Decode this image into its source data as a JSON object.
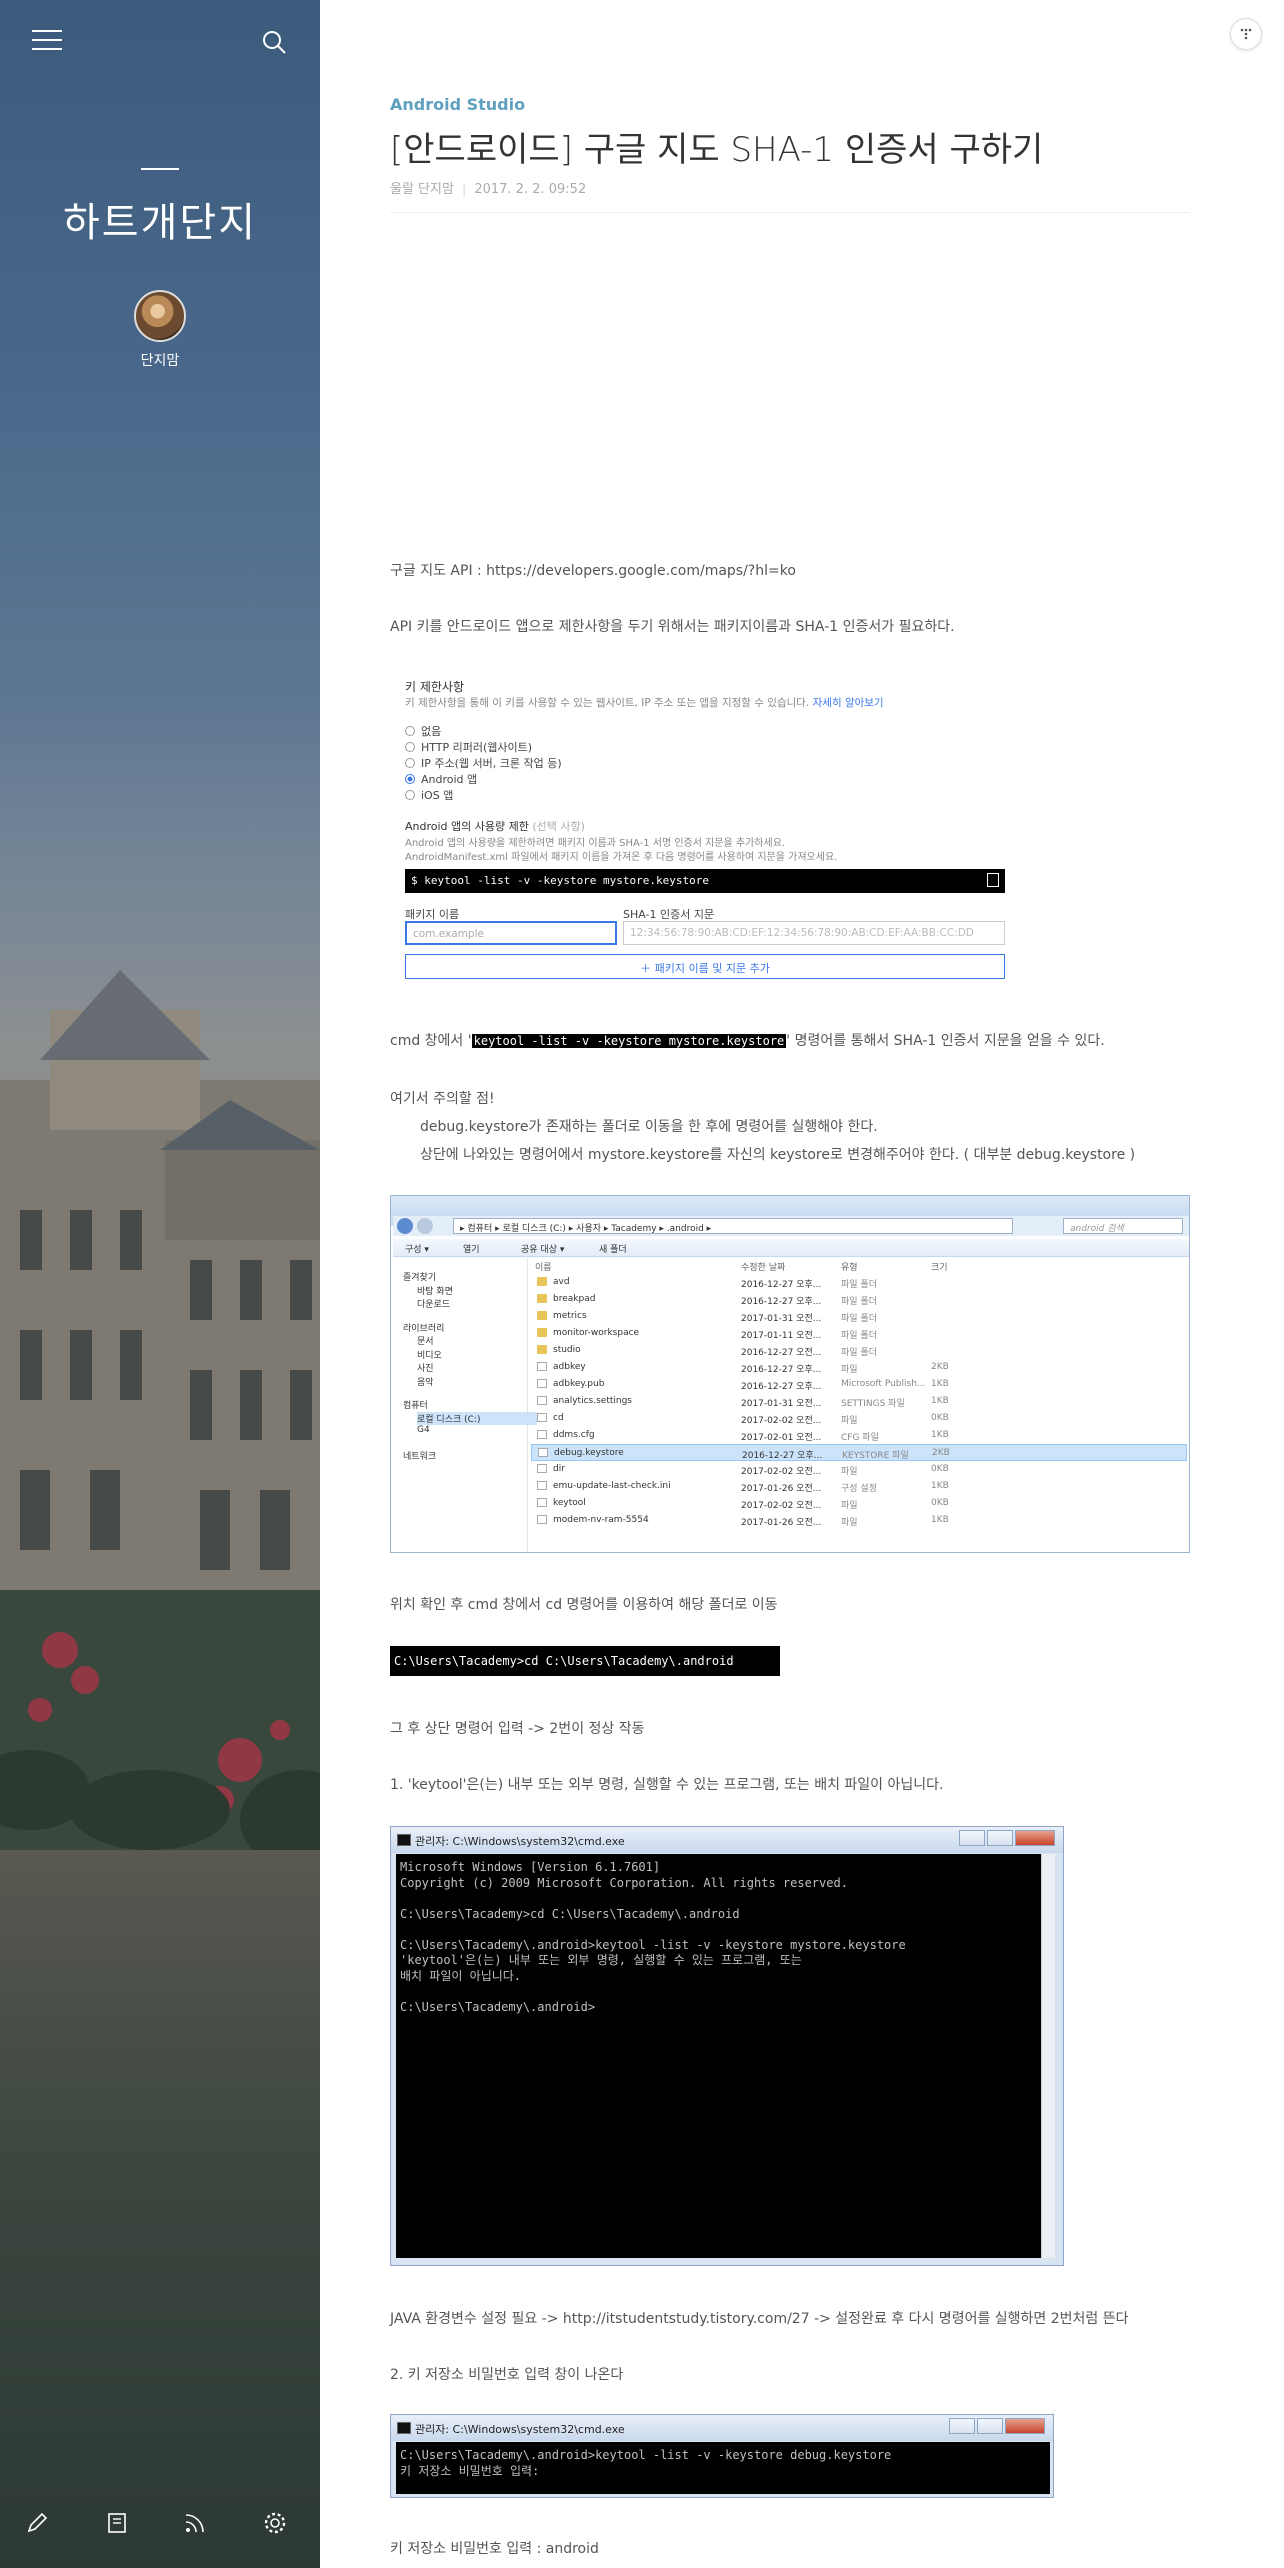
{
  "sidebar": {
    "blog_title": "하트개단지",
    "nickname": "단지맘",
    "icons": [
      "menu-icon",
      "search-icon",
      "pencil-icon",
      "book-icon",
      "rss-icon",
      "gear-icon"
    ]
  },
  "post": {
    "category": "Android Studio",
    "title": "[안드로이드] 구글 지도 SHA-1 인증서 구하기",
    "author": "울랄 단지맘",
    "date": "2017. 2. 2. 09:52",
    "p1": "구글 지도 API : https://developers.google.com/maps/?hl=ko",
    "p2": "API 키를 안드로이드 앱으로 제한사항을 두기 위해서는 패키지이름과 SHA-1 인증서가 필요하다.",
    "p3_pre": "cmd 창에서 '",
    "p3_code": "keytool -list -v -keystore mystore.keystore",
    "p3_post": "' 명령어를 통해서 SHA-1 인증서 지문을 얻을 수 있다.",
    "p4": "여기서 주의할 점!",
    "p5": "debug.keystore가 존재하는 폴더로 이동을 한 후에 명령어를 실행해야 한다.",
    "p6": "상단에 나와있는 명령어에서 mystore.keystore를 자신의 keystore로 변경해주어야 한다. ( 대부분 debug.keystore )",
    "p7": "위치 확인 후 cmd 창에서 cd 명령어를 이용하여 해당 폴더로 이동",
    "cmd_cd": "C:\\Users\\Tacademy>cd C:\\Users\\Tacademy\\.android",
    "p8": "그 후 상단 명령어 입력 -> 2번이 정상 작동",
    "p9": "1. 'keytool'은(는) 내부 또는 외부 명령, 실행할 수 있는 프로그램, 또는 배치 파일이 아닙니다.",
    "p10": "JAVA 환경변수 설정 필요 -> http://itstudentstudy.tistory.com/27 -> 설정완료 후 다시 명령어를 실행하면 2번처럼 뜬다",
    "p11": "2. 키 저장소 비밀번호 입력 창이 나온다",
    "p12": "키 저장소 비밀번호 입력 : android"
  },
  "keyform": {
    "heading": "키 제한사항",
    "sub": "키 제한사항을 통해 이 키를 사용할 수 있는 웹사이트, IP 주소 또는 앱을 지정할 수 있습니다.",
    "sub_link": "자세히 알아보기",
    "radios": [
      "없음",
      "HTTP 리퍼러(웹사이트)",
      "IP 주소(웹 서버, 크론 작업 등)",
      "Android 앱",
      "iOS 앱"
    ],
    "selected_radio": "Android 앱",
    "limit_label": "Android 앱의 사용량 제한",
    "limit_optional": "(선택 사항)",
    "limit_desc1": "Android 앱의 사용량을 제한하려면 패키지 이름과 SHA-1 서명 인증서 지문을 추가하세요.",
    "limit_desc2": "AndroidManifest.xml 파일에서 패키지 이름을 가져온 후 다음 명령어를 사용하여 지문을 가져오세요.",
    "command": "$ keytool -list -v -keystore mystore.keystore",
    "pkg_label": "패키지 이름",
    "pkg_placeholder": "com.example",
    "sha_label": "SHA-1 인증서 지문",
    "sha_placeholder": "12:34:56:78:90:AB:CD:EF:12:34:56:78:90:AB:CD:EF:AA:BB:CC:DD",
    "add_button": "패키지 이름 및 지문 추가"
  },
  "explorer": {
    "address": "▸ 컴퓨터 ▸ 로컬 디스크 (C:) ▸ 사용자 ▸ Tacademy ▸ .android ▸",
    "search": "android 검색",
    "toolbar": [
      "구성 ▾",
      "열기",
      "공유 대상 ▾",
      "새 폴더"
    ],
    "nav": [
      {
        "label": "즐겨찾기",
        "indent": 0
      },
      {
        "label": "바탕 화면",
        "indent": 1
      },
      {
        "label": "다운로드",
        "indent": 1
      },
      {
        "label": "라이브러리",
        "indent": 0
      },
      {
        "label": "문서",
        "indent": 1
      },
      {
        "label": "비디오",
        "indent": 1
      },
      {
        "label": "사진",
        "indent": 1
      },
      {
        "label": "음악",
        "indent": 1
      },
      {
        "label": "컴퓨터",
        "indent": 0
      },
      {
        "label": "로컬 디스크 (C:)",
        "indent": 1,
        "selected": true
      },
      {
        "label": "G4",
        "indent": 1
      },
      {
        "label": "네트워크",
        "indent": 0
      }
    ],
    "columns": [
      "이름",
      "수정한 날짜",
      "유형",
      "크기"
    ],
    "rows": [
      {
        "name": "avd",
        "date": "2016-12-27 오후...",
        "type": "파일 폴더",
        "size": "",
        "folder": true
      },
      {
        "name": "breakpad",
        "date": "2016-12-27 오후...",
        "type": "파일 폴더",
        "size": "",
        "folder": true
      },
      {
        "name": "metrics",
        "date": "2017-01-31 오전...",
        "type": "파일 폴더",
        "size": "",
        "folder": true
      },
      {
        "name": "monitor-workspace",
        "date": "2017-01-11 오전...",
        "type": "파일 폴더",
        "size": "",
        "folder": true
      },
      {
        "name": "studio",
        "date": "2016-12-27 오전...",
        "type": "파일 폴더",
        "size": "",
        "folder": true
      },
      {
        "name": "adbkey",
        "date": "2016-12-27 오후...",
        "type": "파일",
        "size": "2KB",
        "folder": false
      },
      {
        "name": "adbkey.pub",
        "date": "2016-12-27 오후...",
        "type": "Microsoft Publish...",
        "size": "1KB",
        "folder": false
      },
      {
        "name": "analytics.settings",
        "date": "2017-01-31 오전...",
        "type": "SETTINGS 파일",
        "size": "1KB",
        "folder": false
      },
      {
        "name": "cd",
        "date": "2017-02-02 오전...",
        "type": "파일",
        "size": "0KB",
        "folder": false
      },
      {
        "name": "ddms.cfg",
        "date": "2017-02-01 오전...",
        "type": "CFG 파일",
        "size": "1KB",
        "folder": false
      },
      {
        "name": "debug.keystore",
        "date": "2016-12-27 오후...",
        "type": "KEYSTORE 파일",
        "size": "2KB",
        "folder": false,
        "selected": true
      },
      {
        "name": "dir",
        "date": "2017-02-02 오전...",
        "type": "파일",
        "size": "0KB",
        "folder": false
      },
      {
        "name": "emu-update-last-check.ini",
        "date": "2017-01-26 오전...",
        "type": "구성 설정",
        "size": "1KB",
        "folder": false
      },
      {
        "name": "keytool",
        "date": "2017-02-02 오전...",
        "type": "파일",
        "size": "0KB",
        "folder": false
      },
      {
        "name": "modem-nv-ram-5554",
        "date": "2017-01-26 오전...",
        "type": "파일",
        "size": "1KB",
        "folder": false
      }
    ]
  },
  "cmd_window1": {
    "title": "관리자: C:\\Windows\\system32\\cmd.exe",
    "lines": "Microsoft Windows [Version 6.1.7601]\nCopyright (c) 2009 Microsoft Corporation. All rights reserved.\n\nC:\\Users\\Tacademy>cd C:\\Users\\Tacademy\\.android\n\nC:\\Users\\Tacademy\\.android>keytool -list -v -keystore mystore.keystore\n'keytool'은(는) 내부 또는 외부 명령, 실행할 수 있는 프로그램, 또는\n배치 파일이 아닙니다.\n\nC:\\Users\\Tacademy\\.android>"
  },
  "cmd_window2": {
    "title": "관리자: C:\\Windows\\system32\\cmd.exe",
    "lines": "C:\\Users\\Tacademy\\.android>keytool -list -v -keystore debug.keystore\n키 저장소 비밀번호 입력:"
  },
  "colors": {
    "category": "#5f9fc0",
    "link": "#3b78e7",
    "terminal_bg": "#000000"
  }
}
